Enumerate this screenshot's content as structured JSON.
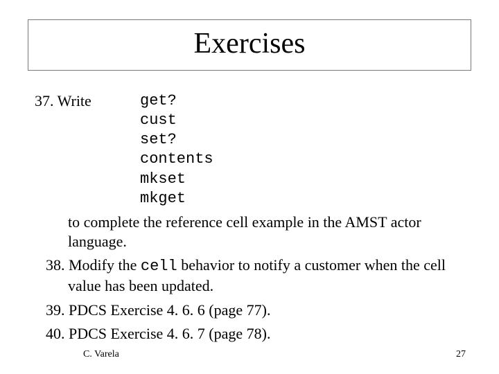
{
  "title": "Exercises",
  "item37": {
    "prompt": "37. Write",
    "code_lines": [
      "get?",
      "cust",
      "set?",
      "contents",
      "mkset",
      "mkget"
    ],
    "tail": "to complete the reference cell example in the AMST actor language."
  },
  "item38": {
    "pre": "38. Modify the ",
    "mono": "cell",
    "post": " behavior to notify a customer when the cell value has been updated."
  },
  "item39": "39. PDCS Exercise 4. 6. 6 (page 77).",
  "item40": "40. PDCS Exercise 4. 6. 7 (page 78).",
  "footer": {
    "author": "C. Varela",
    "number": "27"
  }
}
